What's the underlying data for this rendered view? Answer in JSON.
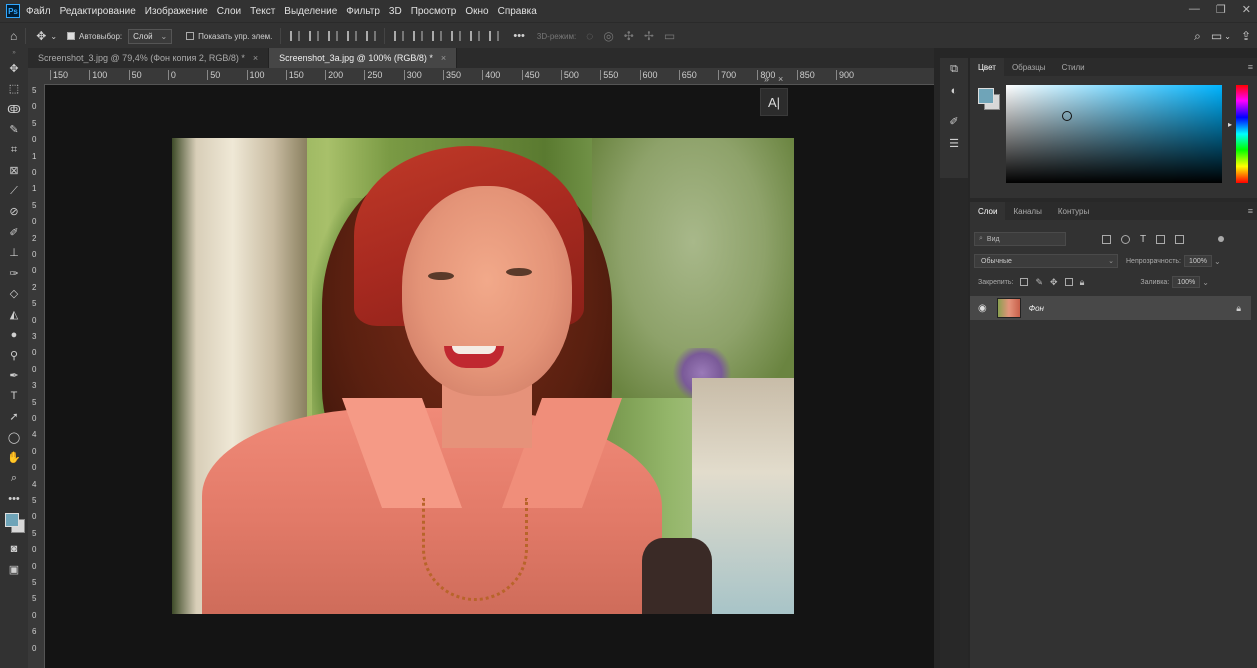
{
  "menubar": {
    "logo": "Ps",
    "items": [
      "Файл",
      "Редактирование",
      "Изображение",
      "Слои",
      "Текст",
      "Выделение",
      "Фильтр",
      "3D",
      "Просмотр",
      "Окно",
      "Справка"
    ],
    "window_controls": [
      "—",
      "❐",
      "✕"
    ]
  },
  "options": {
    "autoselect_label": "Автовыбор:",
    "autoselect_value": "Слой",
    "show_transform_label": "Показать упр. элем.",
    "mode_3d_label": "3D-режим:",
    "more": "•••"
  },
  "tabs": [
    {
      "label": "Screenshot_3.jpg @ 79,4% (Фон копия 2, RGB/8) *",
      "close": "×"
    },
    {
      "label": "Screenshot_3a.jpg @ 100% (RGB/8) *",
      "close": "×"
    }
  ],
  "tab_overflow": "»",
  "tab_close_all": "×",
  "ruler": {
    "h_ticks": [
      "150",
      "100",
      "50",
      "0",
      "50",
      "100",
      "150",
      "200",
      "250",
      "300",
      "350",
      "400",
      "450",
      "500",
      "550",
      "600",
      "650",
      "700",
      "800",
      "850",
      "900"
    ],
    "v_ticks": [
      "5",
      "0",
      "5",
      "0",
      "1",
      "0",
      "1",
      "5",
      "0",
      "2",
      "0",
      "0",
      "2",
      "5",
      "0",
      "3",
      "0",
      "0",
      "3",
      "5",
      "0",
      "4",
      "0",
      "0",
      "4",
      "5",
      "0",
      "5",
      "0",
      "0",
      "5",
      "5",
      "0",
      "6",
      "0"
    ]
  },
  "type_button": "A|",
  "color_panel": {
    "tabs": [
      "Цвет",
      "Образцы",
      "Стили"
    ],
    "fg_color": "#6fa4b8",
    "bg_color": "#d8d8d8",
    "menu": "≡"
  },
  "layers_panel": {
    "tabs": [
      "Слои",
      "Каналы",
      "Контуры"
    ],
    "menu": "≡",
    "search_placeholder": "Вид",
    "blend_mode": "Обычные",
    "opacity_label": "Непрозрачность:",
    "opacity_value": "100%",
    "lock_label": "Закрепить:",
    "fill_label": "Заливка:",
    "fill_value": "100%",
    "layers": [
      {
        "name": "Фон",
        "visible": true,
        "locked": true
      }
    ]
  },
  "tools": [
    "move-tool",
    "marquee-tool",
    "lasso-tool",
    "quick-select-tool",
    "crop-tool",
    "frame-tool",
    "eyedropper-tool",
    "healing-brush-tool",
    "brush-tool",
    "stamp-tool",
    "history-brush-tool",
    "eraser-tool",
    "paint-bucket-tool",
    "blur-tool",
    "dodge-tool",
    "pen-tool",
    "type-tool",
    "path-select-tool",
    "ellipse-tool",
    "hand-tool",
    "zoom-tool",
    "more-tools",
    "color-swatches",
    "quick-mask",
    "screen-mode"
  ]
}
